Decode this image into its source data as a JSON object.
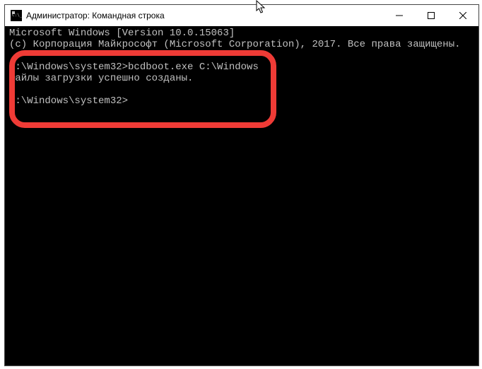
{
  "window": {
    "title": "Администратор: Командная строка"
  },
  "controls": {
    "minimize": "minimize",
    "maximize": "maximize",
    "close": "close"
  },
  "terminal": {
    "line1": "Microsoft Windows [Version 10.0.15063]",
    "line2": "(c) Корпорация Майкрософт (Microsoft Corporation), 2017. Все права защищены.",
    "blank1": "",
    "prompt1_path": "C:\\Windows\\system32>",
    "prompt1_cmd": "bcdboot.exe C:\\Windows",
    "result1": "Файлы загрузки успешно созданы.",
    "blank2": "",
    "prompt2_path": "C:\\Windows\\system32>",
    "prompt2_cmd": ""
  }
}
